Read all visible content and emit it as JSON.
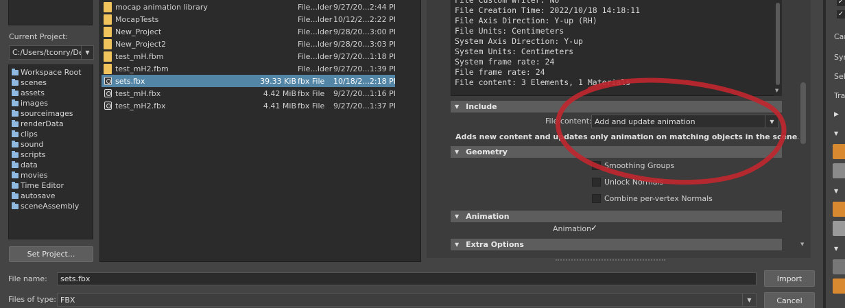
{
  "current_project": {
    "label": "Current Project:",
    "path": "C:/Users/tconry/De"
  },
  "folders": [
    "Workspace Root",
    "scenes",
    "assets",
    "images",
    "sourceimages",
    "renderData",
    "clips",
    "sound",
    "scripts",
    "data",
    "movies",
    "Time Editor",
    "autosave",
    "sceneAssembly"
  ],
  "set_project_label": "Set Project...",
  "files": [
    {
      "name": "mocap animation library",
      "size": "",
      "type": "File...lder",
      "date": "9/27/20...2:44 PM",
      "kind": "folder"
    },
    {
      "name": "MocapTests",
      "size": "",
      "type": "File...lder",
      "date": "10/12/2...2:22 PM",
      "kind": "folder"
    },
    {
      "name": "New_Project",
      "size": "",
      "type": "File...lder",
      "date": "9/28/20...3:00 PM",
      "kind": "folder"
    },
    {
      "name": "New_Project2",
      "size": "",
      "type": "File...lder",
      "date": "9/28/20...3:03 PM",
      "kind": "folder"
    },
    {
      "name": "test_mH.fbm",
      "size": "",
      "type": "File...lder",
      "date": "9/27/20...1:18 PM",
      "kind": "folder"
    },
    {
      "name": "test_mH2.fbm",
      "size": "",
      "type": "File...lder",
      "date": "9/27/20...1:39 PM",
      "kind": "folder"
    },
    {
      "name": "sets.fbx",
      "size": "39.33 KiB",
      "type": "fbx File",
      "date": "10/18/2...2:18 PM",
      "kind": "fbx"
    },
    {
      "name": "test_mH.fbx",
      "size": "4.42 MiB",
      "type": "fbx File",
      "date": "9/27/20...1:16 PM",
      "kind": "fbx"
    },
    {
      "name": "test_mH2.fbx",
      "size": "4.41 MiB",
      "type": "fbx File",
      "date": "9/27/20...1:37 PM",
      "kind": "fbx"
    }
  ],
  "selected_file_index": 6,
  "file_info_lines": [
    "File Custom Writer: No",
    "File Creation Time: 2022/10/18  14:18:11",
    "File Axis Direction: Y-up (RH)",
    "File Units: Centimeters",
    "System Axis Direction: Y-up",
    "System Units: Centimeters",
    "System frame rate: 24",
    "File frame rate: 24",
    "File content: 3 Elements, 1 Materials"
  ],
  "include": {
    "title": "Include",
    "file_content_label": "File content:",
    "file_content_value": "Add and update animation",
    "note": "Adds new content and updates only animation on matching objects in the scene."
  },
  "geometry": {
    "title": "Geometry",
    "options": [
      {
        "label": "Smoothing Groups",
        "checked": false
      },
      {
        "label": "Unlock Normals",
        "checked": false
      },
      {
        "label": "Combine per-vertex Normals",
        "checked": false
      }
    ]
  },
  "animation": {
    "title": "Animation",
    "option_label": "Animation",
    "checked": true
  },
  "extra_options": {
    "title": "Extra Options"
  },
  "bottom": {
    "file_name_label": "File name:",
    "file_name_value": "sets.fbx",
    "files_of_type_label": "Files of type:",
    "files_of_type_value": "FBX",
    "import_label": "Import",
    "cancel_label": "Cancel"
  },
  "right_strip": {
    "labels": [
      "Car",
      "Syr",
      "Sel",
      "Tra"
    ]
  },
  "colors": {
    "selection": "#5285a6",
    "folder": "#f0c35c",
    "annotation": "#c0272d"
  }
}
